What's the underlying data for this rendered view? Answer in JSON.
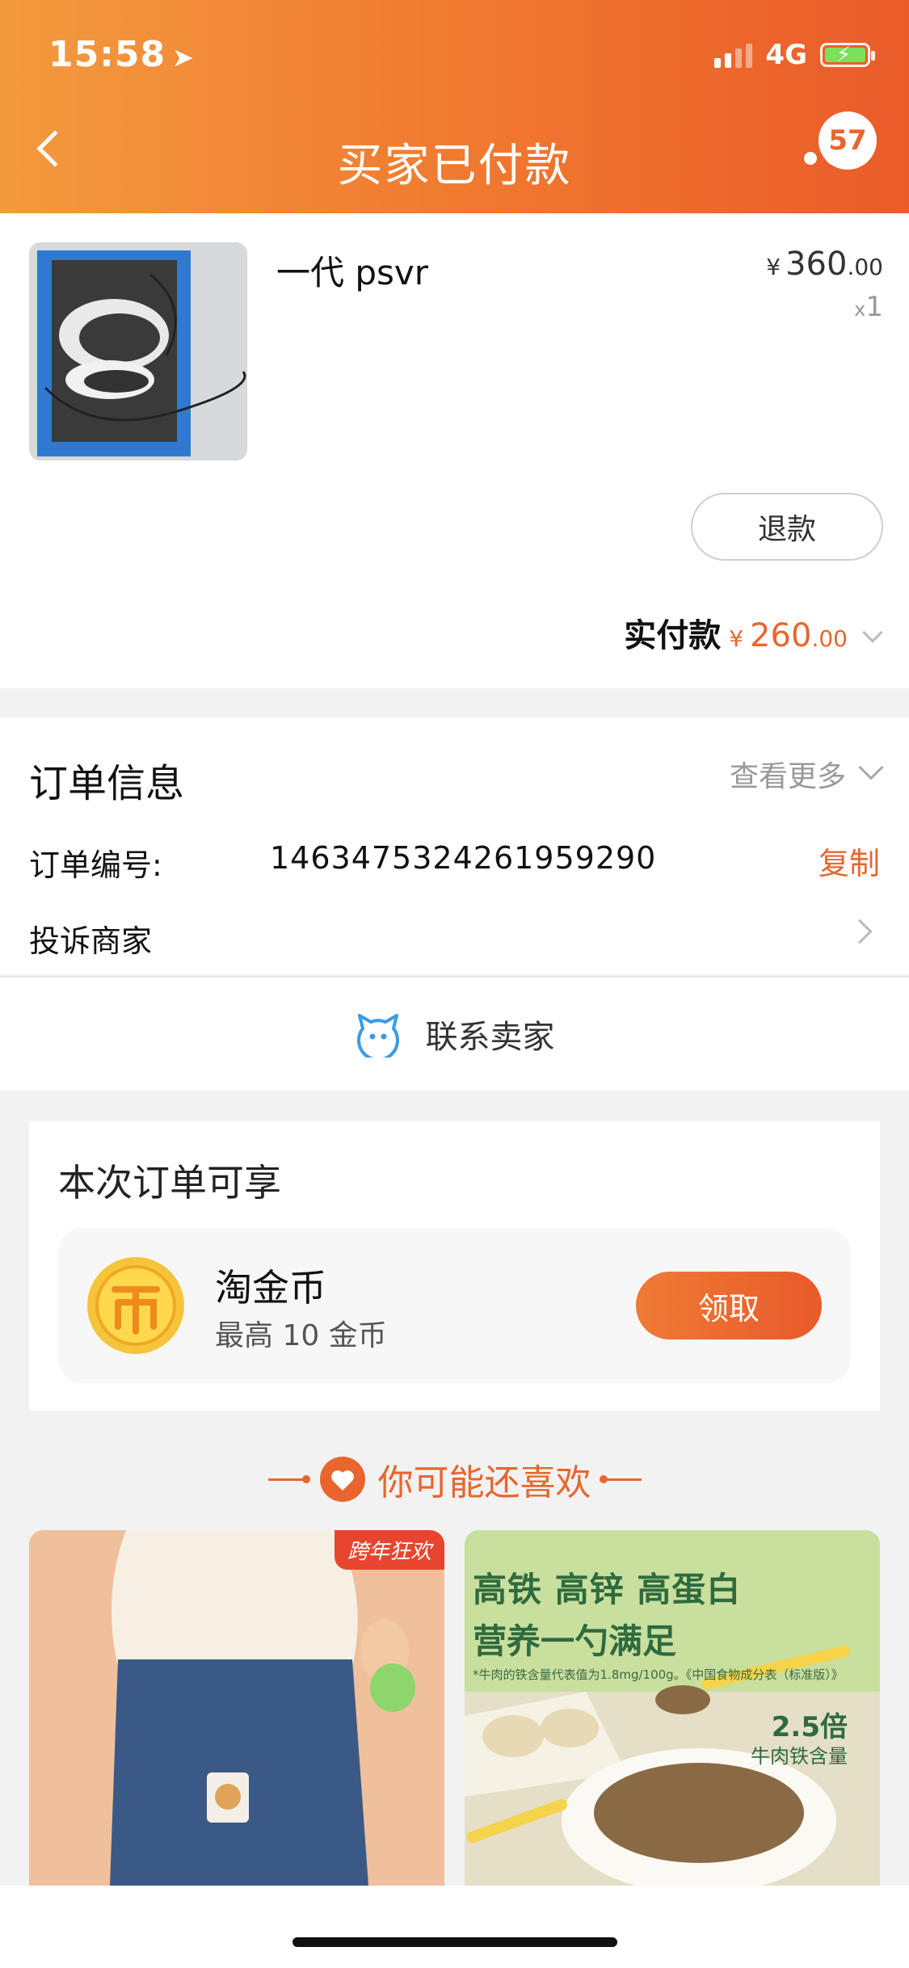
{
  "status_bar": {
    "time": "15:58",
    "network": "4G"
  },
  "header": {
    "title": "买家已付款",
    "badge_count": "57"
  },
  "product": {
    "name": "一代 psvr",
    "price_currency": "¥",
    "price_int": "360",
    "price_dec": ".00",
    "qty_x": "x",
    "qty": "1",
    "refund_label": "退款",
    "paid_label": "实付款",
    "paid_currency": "¥",
    "paid_int": "260",
    "paid_dec": ".00"
  },
  "order_info": {
    "title": "订单信息",
    "view_more": "查看更多",
    "order_no_label": "订单编号:",
    "order_no": "1463475324261959290",
    "copy_label": "复制",
    "complain_label": "投诉商家"
  },
  "contact": {
    "label": "联系卖家"
  },
  "benefit": {
    "title": "本次订单可享",
    "coin_name": "淘金币",
    "coin_sub": "最高 10 金币",
    "claim_label": "领取"
  },
  "recommend": {
    "title": "你可能还喜欢",
    "left_tag": "跨年狂欢",
    "right_h1": "高铁 高锌 高蛋白",
    "right_h2": "营养一勺满足",
    "right_note": "*牛肉的铁含量代表值为1.8mg/100g。《中国食物成分表（标准版）》",
    "right_mult": "2.5倍",
    "right_mult_sub": "牛肉铁含量"
  },
  "colors": {
    "accent": "#e8662e",
    "header_start": "#f39a3e",
    "header_end": "#ea5b2a"
  }
}
